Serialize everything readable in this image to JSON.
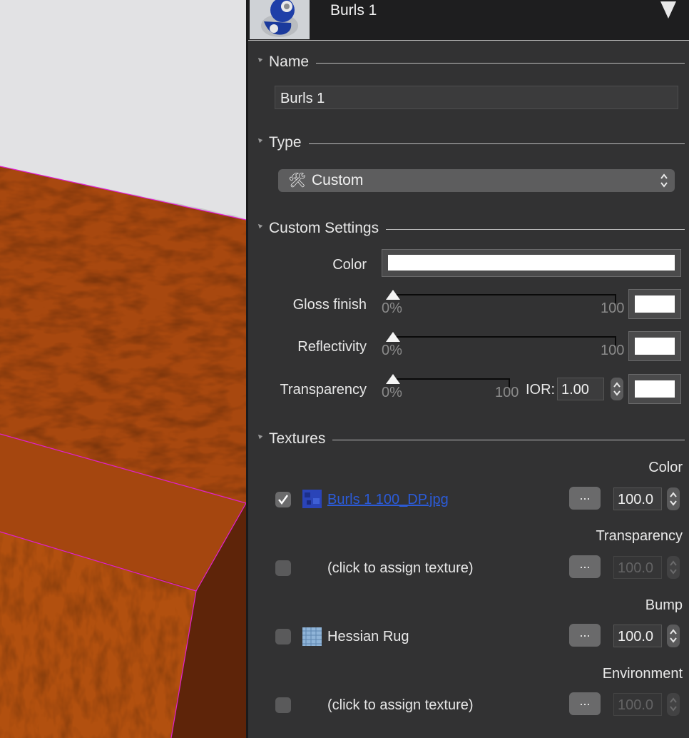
{
  "header": {
    "title": "Burls 1"
  },
  "sections": {
    "name": "Name",
    "type": "Type",
    "custom": "Custom Settings",
    "textures": "Textures"
  },
  "name_field": {
    "value": "Burls 1"
  },
  "type_select": {
    "value": "Custom",
    "icon": "tools-icon"
  },
  "settings": {
    "color_label": "Color",
    "gloss": {
      "label": "Gloss finish",
      "min": "0%",
      "max": "100",
      "value_percent": 0
    },
    "reflectivity": {
      "label": "Reflectivity",
      "min": "0%",
      "max": "100",
      "value_percent": 0
    },
    "transparency": {
      "label": "Transparency",
      "min": "0%",
      "max": "100",
      "value_percent": 0
    },
    "ior": {
      "label": "IOR:",
      "value": "1.00"
    }
  },
  "textures": [
    {
      "heading": "Color",
      "checked": true,
      "name": "Burls 1 100_DP.jpg",
      "has_thumb": true,
      "button": "...",
      "amount": "100.0",
      "enabled": true
    },
    {
      "heading": "Transparency",
      "checked": false,
      "name": "(click to assign texture)",
      "has_thumb": false,
      "button": "...",
      "amount": "100.0",
      "enabled": false
    },
    {
      "heading": "Bump",
      "checked": false,
      "name": "Hessian Rug",
      "has_thumb": true,
      "button": "...",
      "amount": "100.0",
      "enabled": true
    },
    {
      "heading": "Environment",
      "checked": false,
      "name": "(click to assign texture)",
      "has_thumb": false,
      "button": "...",
      "amount": "100.0",
      "enabled": false
    }
  ],
  "colors": {
    "panel": "#323233",
    "header": "#1e1e1f",
    "link": "#2b5bd8",
    "wood": "#a84a12",
    "edge_highlight": "#e01fd0"
  }
}
